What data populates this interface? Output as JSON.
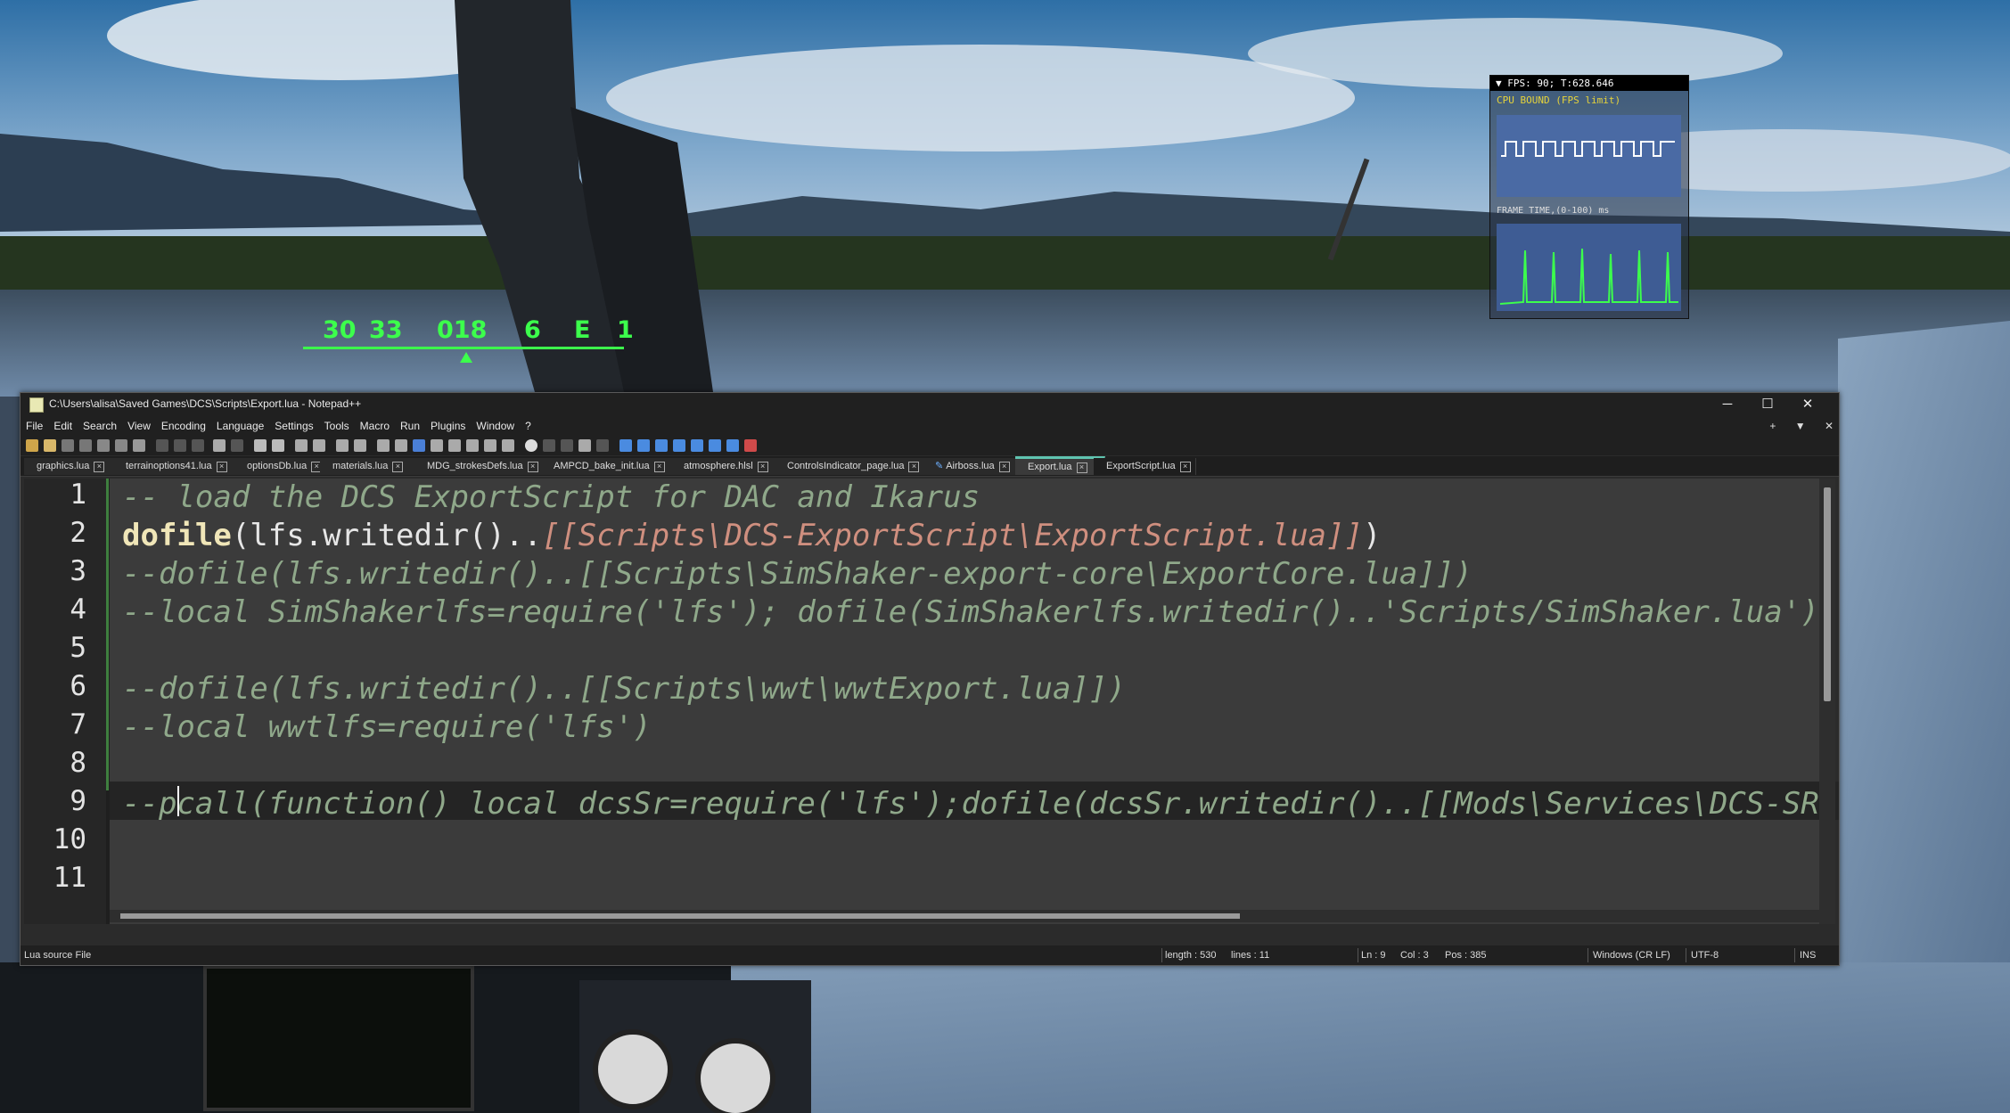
{
  "fps_overlay": {
    "header": "▼ FPS: 90; T:628.646",
    "status": "CPU BOUND (FPS limit)",
    "frame_label": "FRAME TIME,(0-100) ms"
  },
  "hud": {
    "heading_tape": [
      "30",
      "33",
      "018",
      "6",
      "E",
      "1"
    ]
  },
  "window": {
    "title": "C:\\Users\\alisa\\Saved Games\\DCS\\Scripts\\Export.lua - Notepad++",
    "minimize": "─",
    "maximize": "☐",
    "close": "✕"
  },
  "menu": {
    "items": [
      "File",
      "Edit",
      "Search",
      "View",
      "Encoding",
      "Language",
      "Settings",
      "Tools",
      "Macro",
      "Run",
      "Plugins",
      "Window",
      "?"
    ],
    "right": [
      "+",
      "▼",
      "✕"
    ]
  },
  "tabs": [
    {
      "label": "graphics.lua",
      "active": false,
      "modified": false
    },
    {
      "label": "terrainoptions41.lua",
      "active": false,
      "modified": false
    },
    {
      "label": "optionsDb.lua",
      "active": false,
      "modified": false
    },
    {
      "label": "materials.lua",
      "active": false,
      "modified": false
    },
    {
      "label": "MDG_strokesDefs.lua",
      "active": false,
      "modified": false
    },
    {
      "label": "AMPCD_bake_init.lua",
      "active": false,
      "modified": false
    },
    {
      "label": "atmosphere.hlsl",
      "active": false,
      "modified": false
    },
    {
      "label": "ControlsIndicator_page.lua",
      "active": false,
      "modified": false
    },
    {
      "label": "Airboss.lua",
      "active": false,
      "modified": true
    },
    {
      "label": "Export.lua",
      "active": true,
      "modified": false
    },
    {
      "label": "ExportScript.lua",
      "active": false,
      "modified": false
    }
  ],
  "editor": {
    "line_numbers": [
      "1",
      "2",
      "3",
      "4",
      "5",
      "6",
      "7",
      "8",
      "9",
      "10",
      "11"
    ],
    "lines": [
      [
        {
          "t": "-- load the DCS ExportScript for DAC and Ikarus",
          "c": "cmt"
        }
      ],
      [
        {
          "t": "dofile",
          "c": "kw"
        },
        {
          "t": "(lfs.writedir()..",
          "c": "pl"
        },
        {
          "t": "[[Scripts\\DCS-ExportScript\\ExportScript.lua]]",
          "c": "str"
        },
        {
          "t": ")",
          "c": "pl"
        }
      ],
      [
        {
          "t": "--dofile(lfs.writedir()..[[Scripts\\SimShaker-export-core\\ExportCore.lua]])",
          "c": "cmt"
        }
      ],
      [
        {
          "t": "--local SimShakerlfs=require('lfs'); dofile(SimShakerlfs.writedir()..'Scripts/SimShaker.lua')",
          "c": "cmt"
        }
      ],
      [],
      [
        {
          "t": "--dofile(lfs.writedir()..[[Scripts\\wwt\\wwtExport.lua]])",
          "c": "cmt"
        }
      ],
      [
        {
          "t": "--local wwtlfs=require('lfs')",
          "c": "cmt"
        }
      ],
      [],
      [
        {
          "t": "--pcall(function() local dcsSr=require('lfs');dofile(dcsSr.writedir()..[[Mods\\Services\\DCS-SRS\\Scripts\\DCS-SimpleRadioStandalone.lua]]); end,nil)",
          "c": "cmt"
        }
      ],
      [],
      []
    ]
  },
  "status": {
    "file_type": "Lua source File",
    "length": "length : 530",
    "lines": "lines : 11",
    "ln": "Ln : 9",
    "col": "Col : 3",
    "pos": "Pos : 385",
    "eol": "Windows (CR LF)",
    "encoding": "UTF-8",
    "mode": "INS"
  }
}
